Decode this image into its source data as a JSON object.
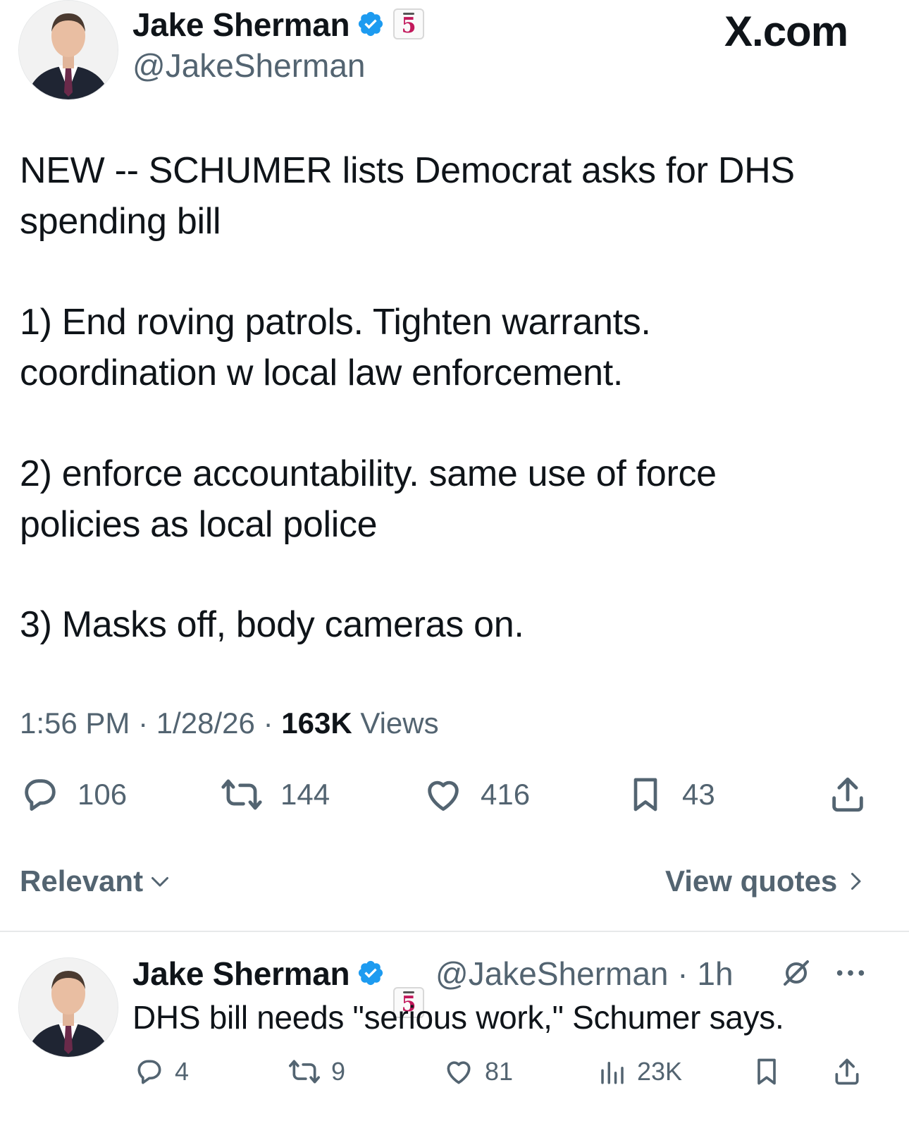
{
  "tweet": {
    "author_name": "Jake Sherman",
    "handle": "@JakeSherman",
    "badge_number": "5",
    "site_label": "X.com",
    "lines": [
      "NEW -- SCHUMER lists Democrat asks for DHS",
      "spending bill",
      "1) End roving patrols. Tighten warrants.",
      "coordination w local law enforcement.",
      "2) enforce accountability. same use of force",
      "policies as local police",
      "3) Masks off, body cameras on."
    ],
    "time": "1:56 PM",
    "date": "1/28/26",
    "views_count": "163K",
    "views_label": "Views",
    "replies": "106",
    "reposts": "144",
    "likes": "416",
    "bookmarks": "43",
    "separator": "·"
  },
  "sort": {
    "relevant_label": "Relevant",
    "view_quotes_label": "View quotes"
  },
  "reply": {
    "author_name": "Jake Sherman",
    "badge_number": "5",
    "handle_time": "@JakeSherman · 1h",
    "text": "DHS bill needs \"serious work,\" Schumer says.",
    "replies": "4",
    "reposts": "9",
    "likes": "81",
    "views": "23K"
  },
  "colors": {
    "verified_blue": "#1d9bf0",
    "secondary_text": "#536471",
    "primary_text": "#0f1419",
    "badge_pink": "#c2185b"
  }
}
